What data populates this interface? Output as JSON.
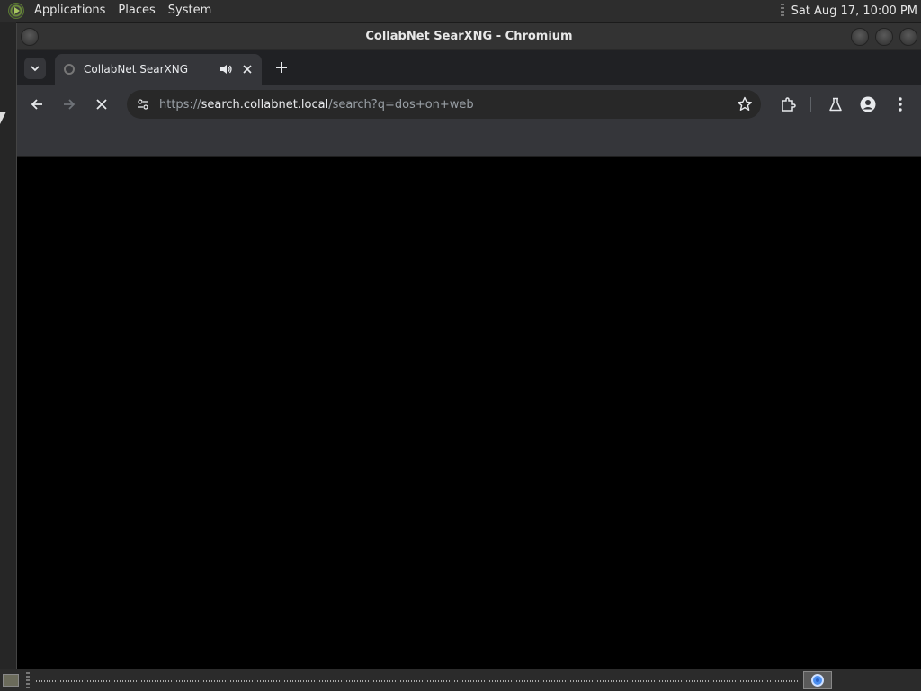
{
  "top_panel": {
    "menus": [
      "Applications",
      "Places",
      "System"
    ],
    "clock": "Sat Aug 17, 10:00 PM"
  },
  "window": {
    "title": "CollabNet SearXNG - Chromium"
  },
  "tabs": [
    {
      "title": "CollabNet SearXNG",
      "audio": true,
      "active": true
    }
  ],
  "toolbar": {
    "url_scheme": "https://",
    "url_host": "search.collabnet.local",
    "url_path": "/search?q=dos+on+web",
    "loading": true
  },
  "icons": {
    "back": "arrow-left-icon",
    "forward": "arrow-right-icon",
    "stop": "close-icon",
    "site_info": "tune-icon",
    "bookmark": "star-icon",
    "extensions": "puzzle-icon",
    "labs": "flask-icon",
    "profile": "person-icon",
    "menu": "kebab-icon"
  },
  "colors": {
    "frame": "#202124",
    "toolbar": "#35363a",
    "omnibox": "#282828",
    "content": "#000000"
  }
}
